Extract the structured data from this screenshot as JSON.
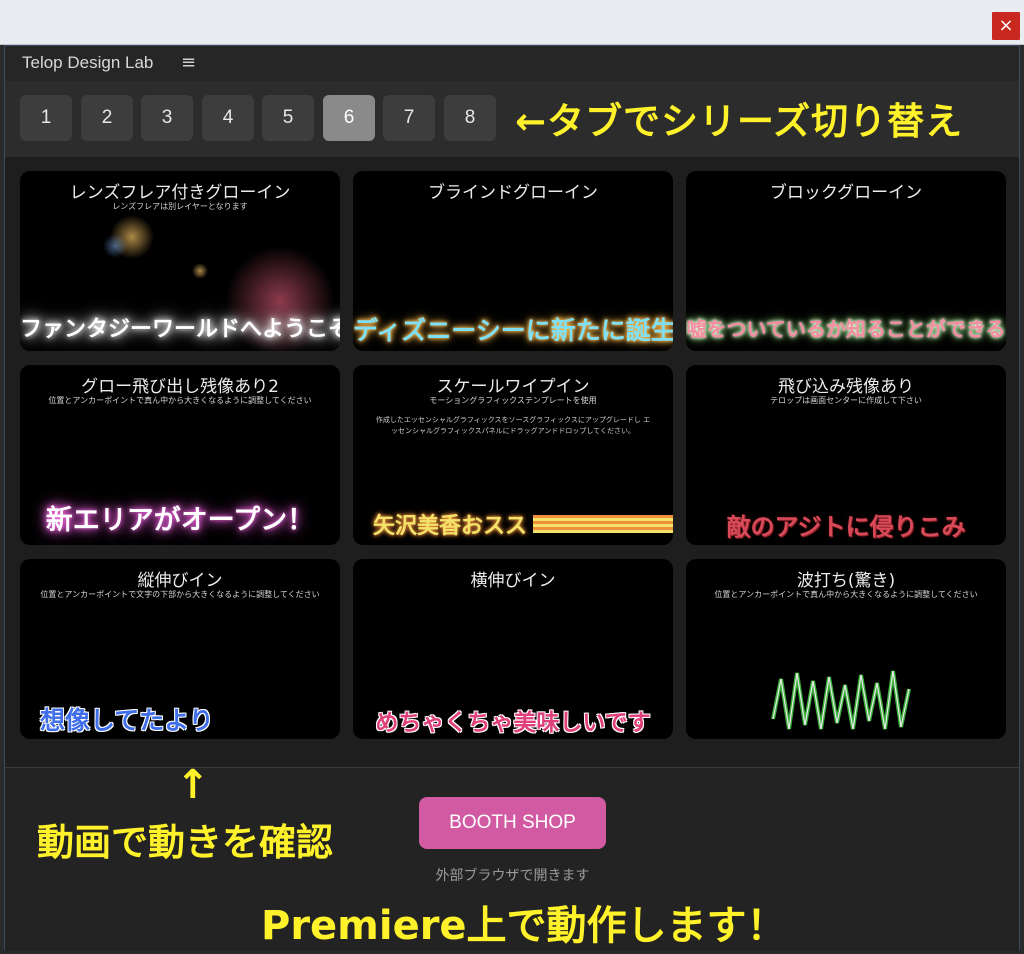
{
  "window": {
    "close_glyph": "×"
  },
  "app": {
    "title": "Telop Design Lab",
    "menu_glyph": "≡"
  },
  "tabs": [
    {
      "label": "1",
      "active": false
    },
    {
      "label": "2",
      "active": false
    },
    {
      "label": "3",
      "active": false
    },
    {
      "label": "4",
      "active": false
    },
    {
      "label": "5",
      "active": false
    },
    {
      "label": "6",
      "active": true
    },
    {
      "label": "7",
      "active": false
    },
    {
      "label": "8",
      "active": false
    }
  ],
  "annotations": {
    "tab_switch": "←タブでシリーズ切り替え",
    "arrow": "↑",
    "check_video": "動画で動きを確認",
    "premiere": "Premiere上で動作します！"
  },
  "cards": [
    {
      "title": "レンズフレア付きグローイン",
      "subtitle": "レンズフレアは別レイヤーとなります",
      "note": "",
      "preview": "ファンタジーワールドへようこそ",
      "preview_color": "#ffffff",
      "glow": "#ffffff",
      "icon": "lens-flare"
    },
    {
      "title": "ブラインドグローイン",
      "subtitle": "",
      "note": "",
      "preview": "ディズニーシーに新たに誕生",
      "preview_color": "#7fe0f5",
      "glow": "#f3b34a",
      "icon": ""
    },
    {
      "title": "ブロックグローイン",
      "subtitle": "",
      "note": "",
      "preview": "嘘をついているか知ることができる",
      "preview_color": "#f58ca0",
      "glow": "#9ff08a",
      "icon": ""
    },
    {
      "title": "グロー飛び出し残像あり2",
      "subtitle": "位置とアンカーポイントで真ん中から大きくなるように調整してください",
      "note": "",
      "preview": "新エリアがオープン！",
      "preview_color": "#ffffff",
      "glow": "#e85fd8",
      "icon": ""
    },
    {
      "title": "スケールワイプイン",
      "subtitle": "モーショングラフィックステンプレートを使用",
      "note": "作成したエッセンシャルグラフィックスをソースグラフィックスにアップグレードし エッセンシャルグラフィックスパネルにドラッグアンドドロップしてください。",
      "preview": "矢沢美香おスス",
      "preview_color": "#f3e36a",
      "glow": "#f08f3a",
      "icon": ""
    },
    {
      "title": "飛び込み残像あり",
      "subtitle": "テロップは画面センターに作成して下さい",
      "note": "",
      "preview": "敵のアジトに侵りこみ",
      "preview_color": "#d84a58",
      "glow": "#8a1f26",
      "icon": ""
    },
    {
      "title": "縦伸びイン",
      "subtitle": "位置とアンカーポイントで文字の下部から大きくなるように調整してください",
      "note": "",
      "preview": "想像してたより",
      "preview_color": "#3f6ee8",
      "glow": "#ffffff",
      "icon": ""
    },
    {
      "title": "横伸びイン",
      "subtitle": "",
      "note": "",
      "preview": "めちゃくちゃ美味しいです",
      "preview_color": "#e0407a",
      "glow": "#ffffff",
      "icon": ""
    },
    {
      "title": "波打ち(驚き)",
      "subtitle": "位置とアンカーポイントで真ん中から大きくなるように調整してください",
      "note": "",
      "preview": "",
      "preview_color": "#3bb03b",
      "glow": "#ffffff",
      "icon": "wave"
    }
  ],
  "footer": {
    "shop_button": "BOOTH SHOP",
    "shop_hint": "外部ブラウザで開きます"
  }
}
